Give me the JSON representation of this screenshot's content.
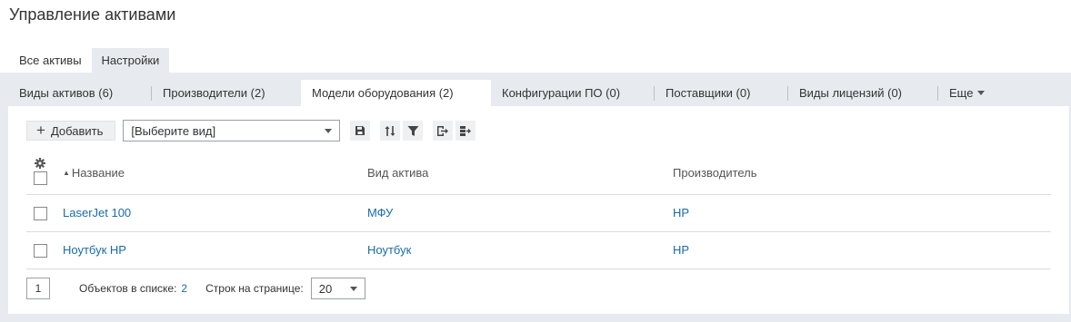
{
  "page_title": "Управление активами",
  "top_tabs": [
    {
      "label": "Все активы"
    },
    {
      "label": "Настройки"
    }
  ],
  "sub_tabs": [
    {
      "label": "Виды активов (6)"
    },
    {
      "label": "Производители (2)"
    },
    {
      "label": "Модели оборудования (2)"
    },
    {
      "label": "Конфигурации ПО (0)"
    },
    {
      "label": "Поставщики (0)"
    },
    {
      "label": "Виды лицензий (0)"
    },
    {
      "label": "Еще"
    }
  ],
  "toolbar": {
    "add_label": "Добавить",
    "view_select_value": "[Выберите вид]",
    "icons": [
      "save-icon",
      "sort-icon",
      "filter-icon",
      "export-icon",
      "columns-export-icon"
    ]
  },
  "table": {
    "headers": {
      "name": "Название",
      "type": "Вид актива",
      "manufacturer": "Производитель"
    },
    "rows": [
      {
        "name": "LaserJet 100",
        "type": "МФУ",
        "manufacturer": "HP"
      },
      {
        "name": "Ноутбук HP",
        "type": "Ноутбук",
        "manufacturer": "HP"
      }
    ]
  },
  "footer": {
    "page": "1",
    "count_label": "Объектов в списке:",
    "count_value": "2",
    "rows_label": "Строк на странице:",
    "rows_value": "20"
  },
  "colors": {
    "panel_bg": "#e7ebef",
    "link": "#1a6ba8",
    "text": "#333333"
  }
}
